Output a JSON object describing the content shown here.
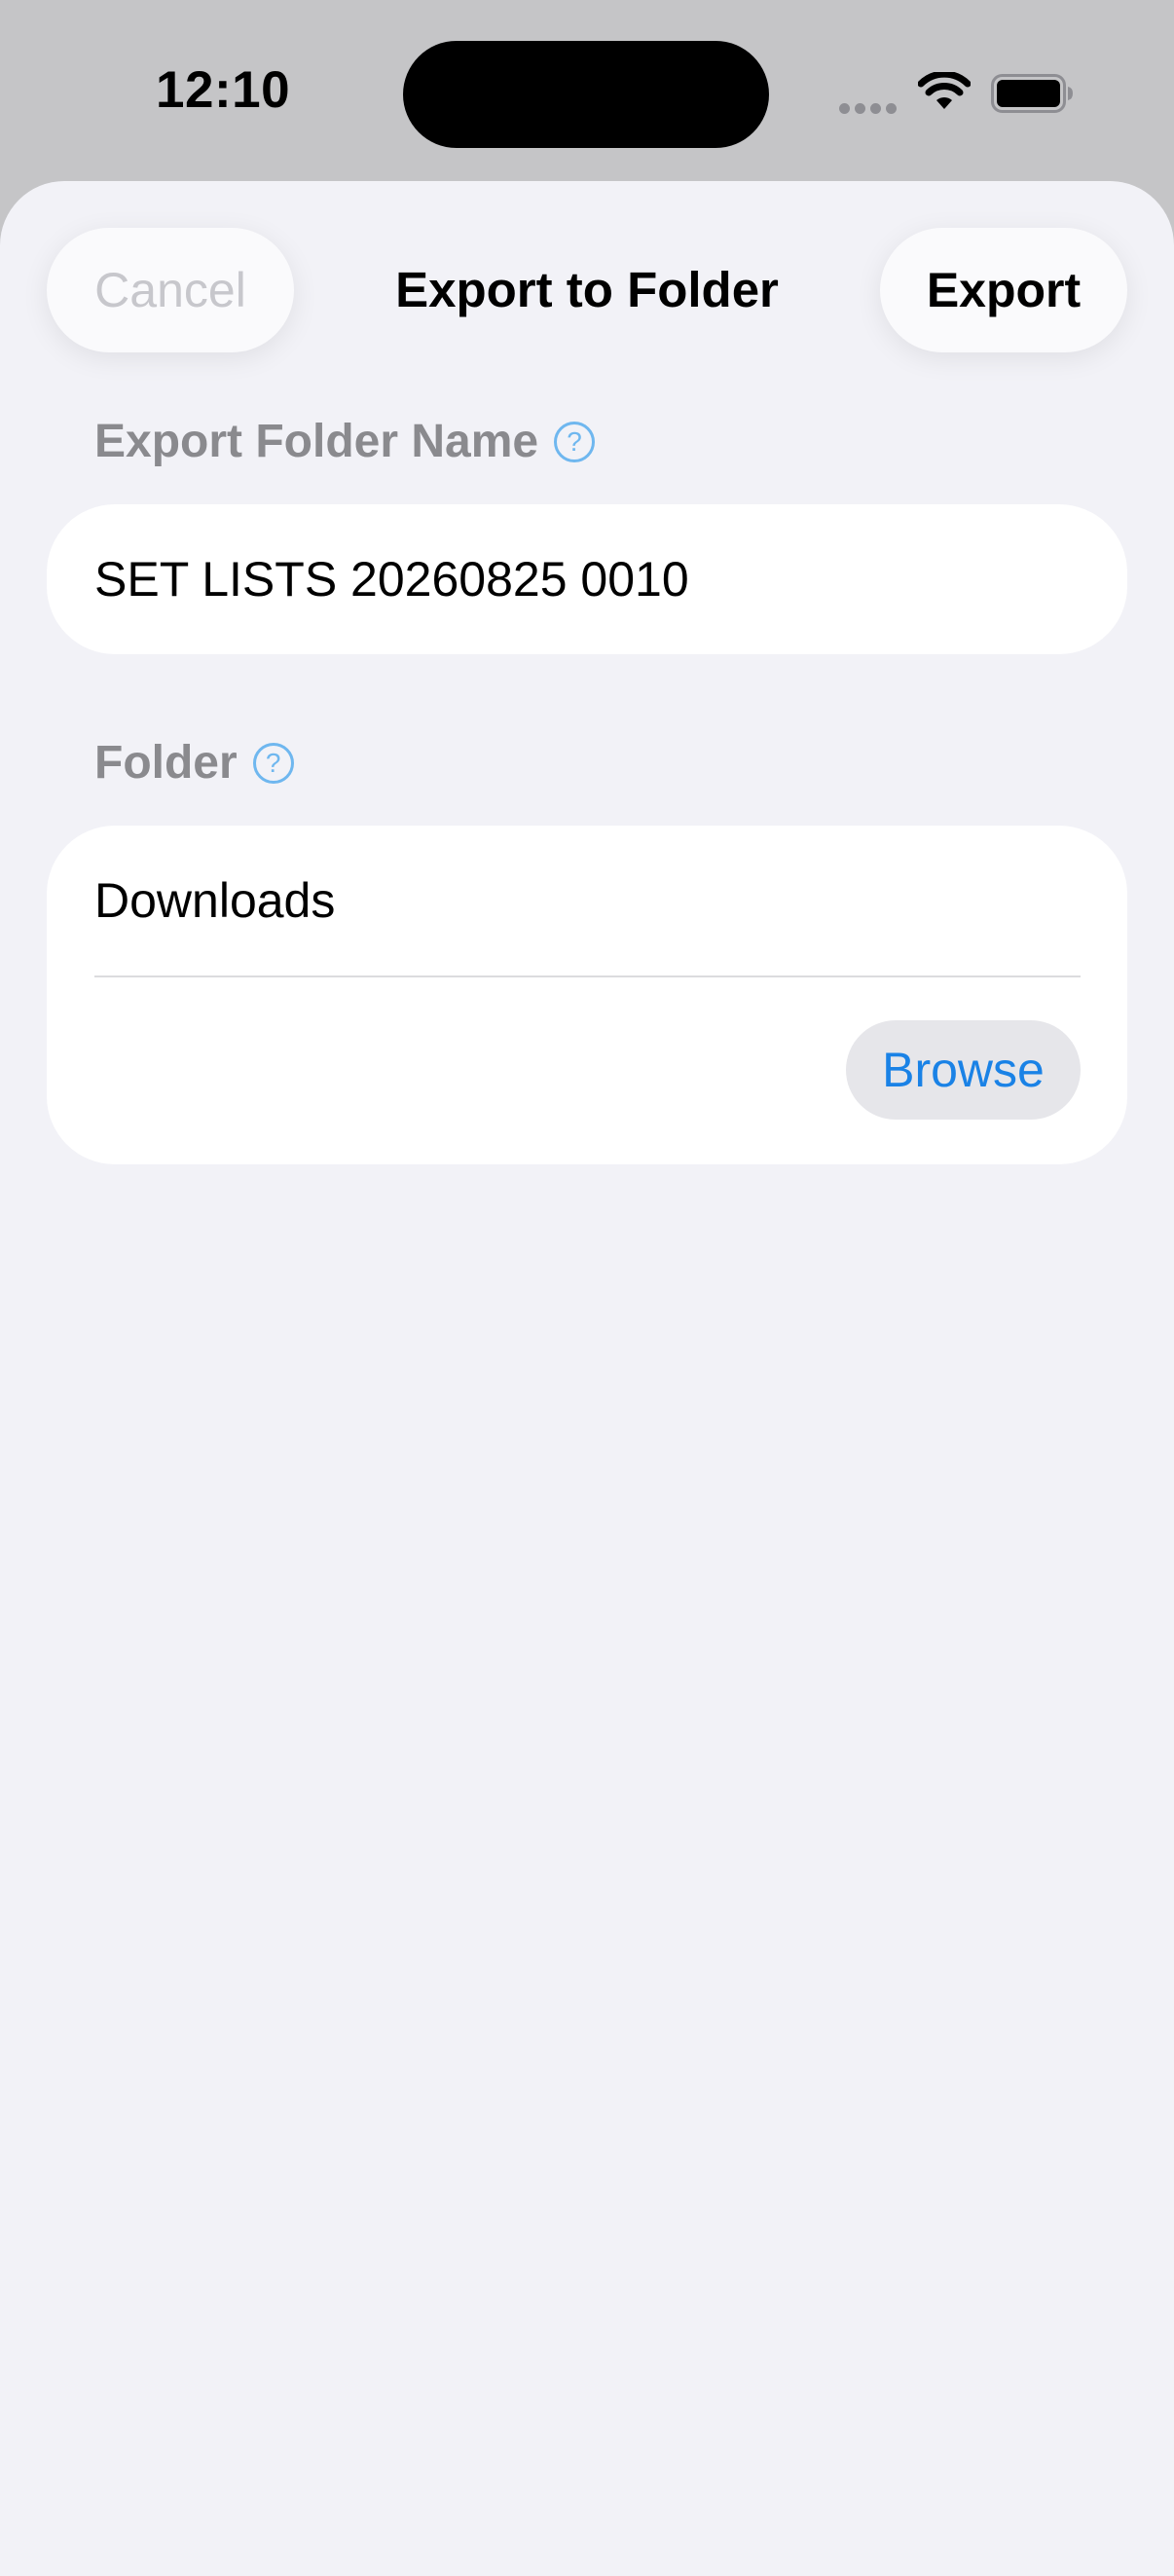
{
  "status_bar": {
    "time": "12:10"
  },
  "header": {
    "cancel_label": "Cancel",
    "title": "Export to Folder",
    "export_label": "Export"
  },
  "export_folder_name": {
    "label": "Export Folder Name",
    "help_glyph": "?",
    "value": "SET LISTS 20260825 0010"
  },
  "folder": {
    "label": "Folder",
    "help_glyph": "?",
    "value": "Downloads",
    "browse_label": "Browse"
  },
  "icons": {
    "signal": "signal-icon",
    "wifi": "wifi-icon",
    "battery": "battery-icon",
    "help": "question-circle-icon"
  },
  "colors": {
    "accent": "#1a82e6",
    "help_icon": "#6fb7ef",
    "sheet_background": "#f2f2f7",
    "label_gray": "#8a8a8e",
    "disabled_text": "#c7c7cc"
  }
}
